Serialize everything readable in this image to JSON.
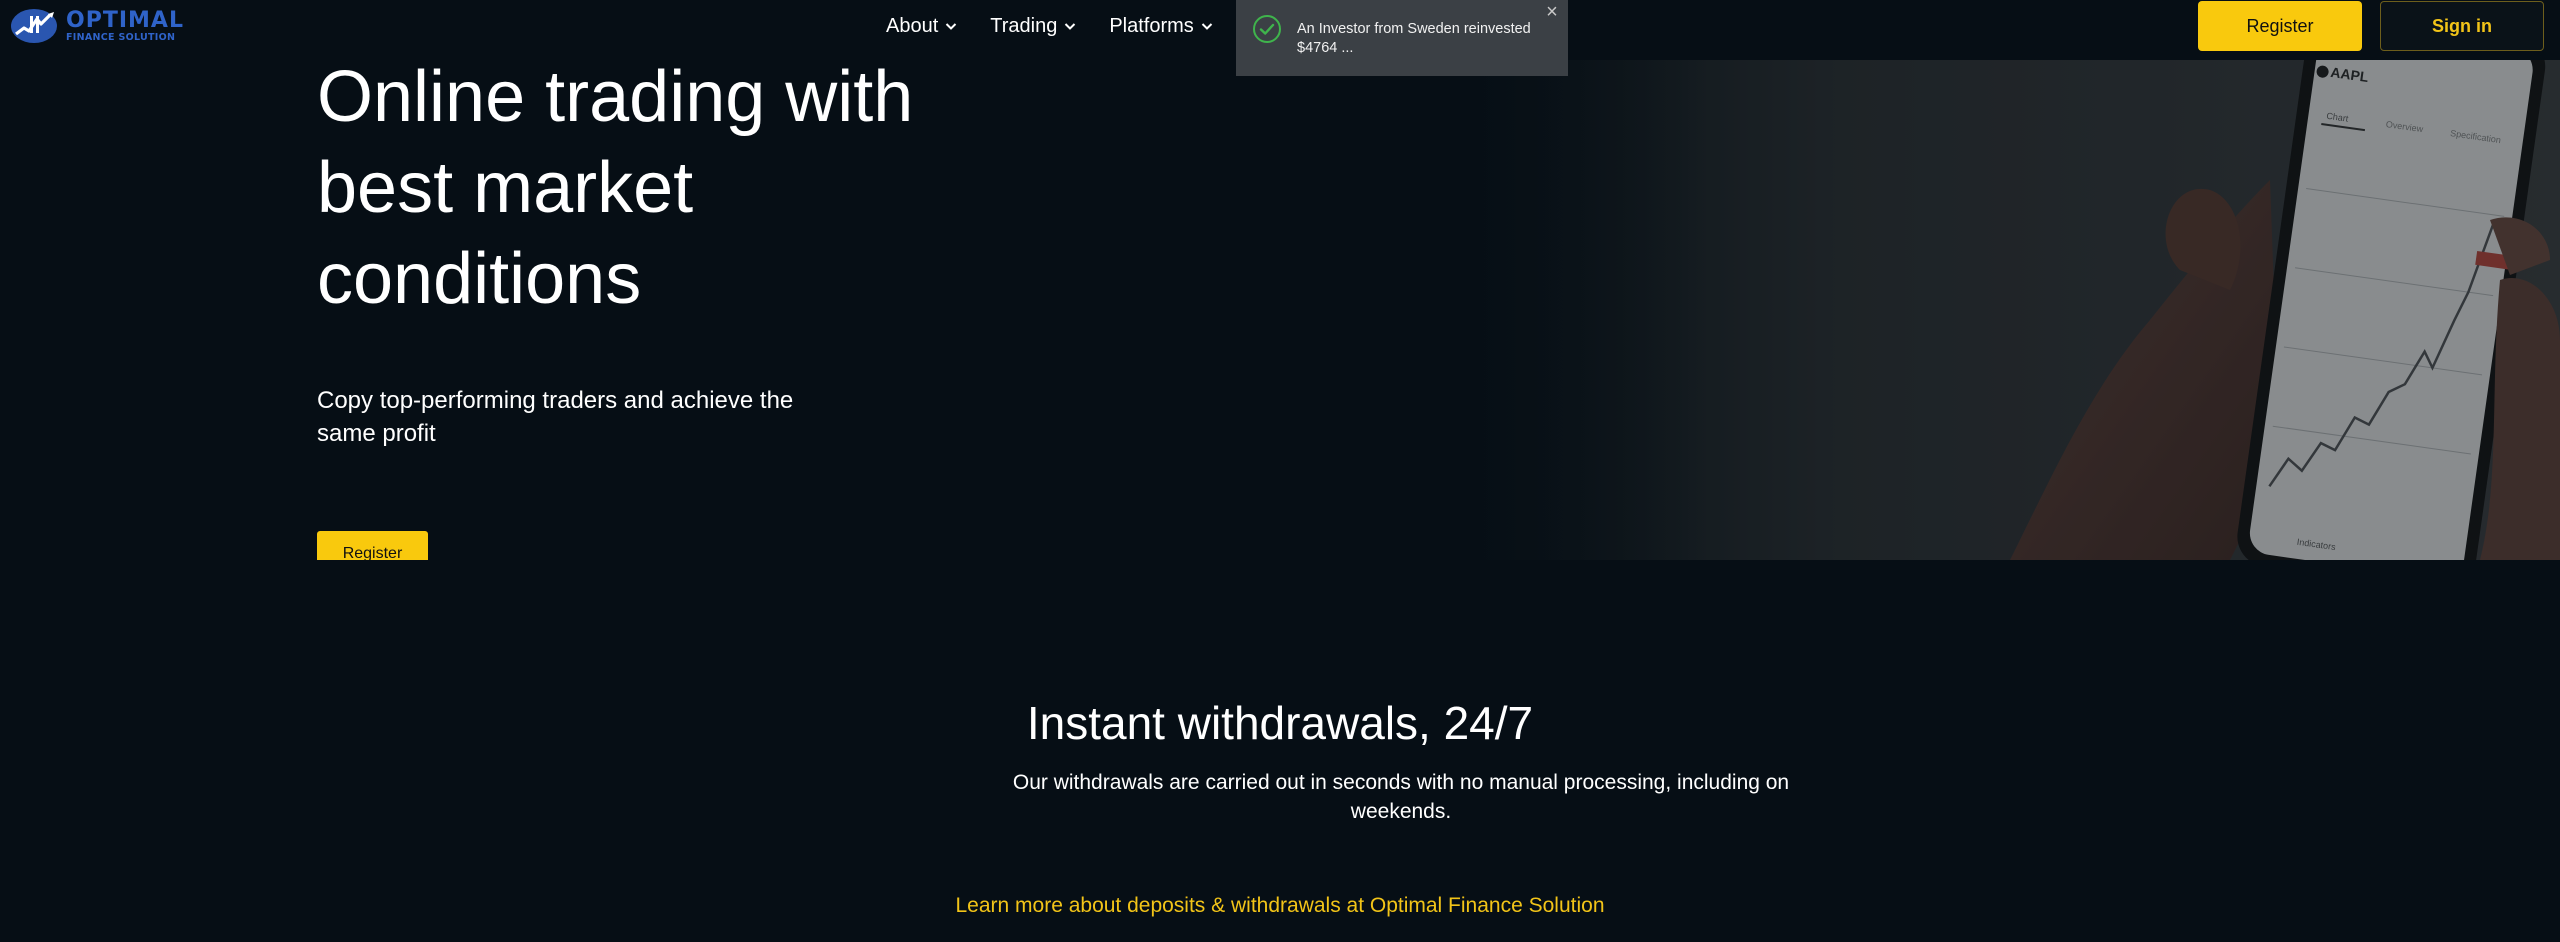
{
  "brand": {
    "name": "OPTIMAL",
    "tagline": "FINANCE SOLUTION",
    "color": "#2f63c9"
  },
  "nav": {
    "items": [
      {
        "label": "About",
        "icon": "chevron-down-icon"
      },
      {
        "label": "Trading",
        "icon": "chevron-down-icon"
      },
      {
        "label": "Platforms",
        "icon": "chevron-down-icon"
      }
    ]
  },
  "header": {
    "register_label": "Register",
    "signin_label": "Sign in"
  },
  "toast": {
    "icon": "check-circle-icon",
    "message": "An Investor from Sweden reinvested $4764 ...",
    "close_icon": "close-icon"
  },
  "hero": {
    "title_lines": [
      "Online trading with",
      "best market",
      "conditions"
    ],
    "subtitle": "Copy top-performing traders and achieve the same profit",
    "cta_label": "Register",
    "phone": {
      "ticker": "AAPL",
      "tabs": [
        "Chart",
        "Overview",
        "Specification"
      ],
      "bottom_label": "Indicators"
    }
  },
  "withdrawals": {
    "title": "Instant withdrawals, 24/7",
    "text": "Our withdrawals are carried out in seconds with no manual processing, including on weekends.",
    "link": "Learn more about deposits & withdrawals at Optimal Finance Solution"
  },
  "colors": {
    "accent": "#f9c90d",
    "background": "#060e15",
    "link": "#f2c418",
    "toast_bg": "#3b4045",
    "success": "#3fb44c"
  }
}
